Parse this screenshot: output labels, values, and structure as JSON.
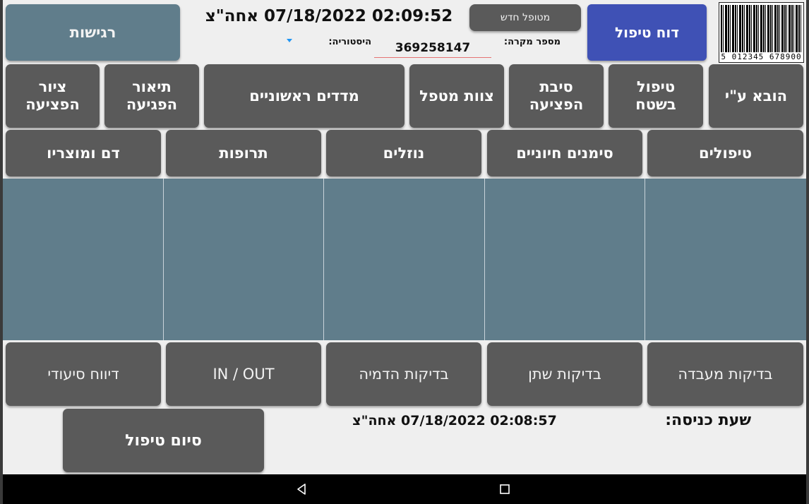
{
  "header": {
    "new_patient_label": "מטופל חדש",
    "treatment_report_label": "דוח טיפול",
    "sensitivities_label": "רגישות",
    "datetime": "02:09:52 07/18/2022 אחה\"צ",
    "case_number_label": "מספר מקרה:",
    "case_number_value": "369258147",
    "history_label": "היסטוריה:",
    "barcode_number": "5 012345 678900"
  },
  "row1": [
    "הובא ע\"י",
    "טיפול\nבשטח",
    "סיבת\nהפציעה",
    "צוות מטפל",
    "מדדים ראשוניים",
    "תיאור\nהפגיעה",
    "ציור\nהפציעה"
  ],
  "row2": [
    "טיפולים",
    "סימנים חיוניים",
    "נוזלים",
    "תרופות",
    "דם ומוצריו"
  ],
  "row3": [
    "בדיקות מעבדה",
    "בדיקות שתן",
    "בדיקות הדמיה",
    "IN / OUT",
    "דיווח סיעודי"
  ],
  "footer": {
    "entry_time_label": "שעת כניסה:",
    "entry_time_value": "02:08:57 07/18/2022 אחה\"צ",
    "end_treatment_label": "סיום טיפול"
  },
  "icons": {
    "back": "back-triangle-icon",
    "home": "home-square-icon",
    "dropdown": "dropdown-arrow-icon"
  },
  "colors": {
    "button_gray": "#5a5a5a",
    "teal": "#607d8b",
    "blue": "#3f51b5",
    "background": "#efefef"
  }
}
